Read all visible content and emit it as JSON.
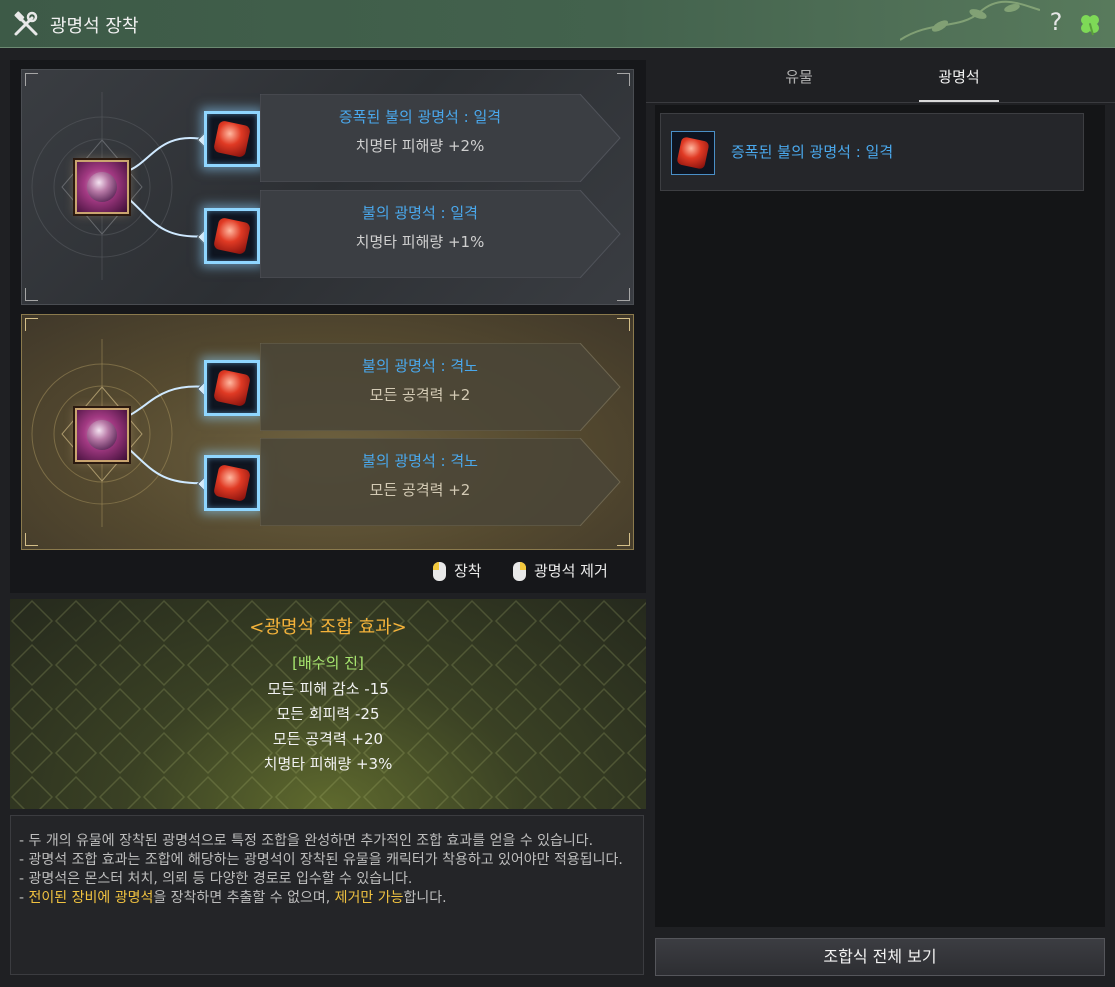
{
  "window": {
    "title": "광명석 장착",
    "title_icon": "crossed-tools-icon",
    "help_label": "?",
    "clover_icon": "four-leaf-clover-icon"
  },
  "sockets": {
    "relic_top": {
      "slot1": {
        "name": "증폭된 불의 광명석 : 일격",
        "stat": "치명타 피해량 +2%"
      },
      "slot2": {
        "name": "불의 광명석 : 일격",
        "stat": "치명타 피해량 +1%"
      }
    },
    "relic_bottom": {
      "slot1": {
        "name": "불의 광명석 : 격노",
        "stat": "모든 공격력 +2"
      },
      "slot2": {
        "name": "불의 광명석 : 격노",
        "stat": "모든 공격력 +2"
      }
    }
  },
  "legend": {
    "equip_label": "장착",
    "remove_label": "광명석 제거"
  },
  "combo": {
    "title": "<광명석 조합 효과>",
    "set_name": "[배수의 진]",
    "effects": [
      "모든 피해 감소 -15",
      "모든 회피력 -25",
      "모든 공격력 +20",
      "치명타 피해량 +3%"
    ]
  },
  "description": {
    "line1": "- 두 개의 유물에 장착된 광명석으로 특정 조합을 완성하면 추가적인 조합 효과를 얻을 수 있습니다.",
    "line2": "- 광명석 조합 효과는 조합에 해당하는 광명석이 장착된 유물을 캐릭터가 착용하고 있어야만 적용됩니다.",
    "line3": "- 광명석은 몬스터 처치, 의뢰 등 다양한 경로로 입수할 수 있습니다.",
    "line4_prefix": "- ",
    "line4_hl1": "전이된 장비에 광명석",
    "line4_mid": "을 장착하면 추출할 수 없으며, ",
    "line4_hl2": "제거만 가능",
    "line4_suffix": "합니다."
  },
  "tabs": [
    {
      "label": "유물",
      "active": false
    },
    {
      "label": "광명석",
      "active": true
    }
  ],
  "gem_list": [
    {
      "name": "증폭된 불의 광명석 : 일격",
      "icon": "fire-gem-icon"
    }
  ],
  "buttons": {
    "view_all_recipes": "조합식 전체 보기"
  },
  "colors": {
    "gem_name": "#4aa8ec",
    "combo_title": "#f4b23a",
    "combo_set": "#a7e66f",
    "highlight": "#f0c240"
  }
}
